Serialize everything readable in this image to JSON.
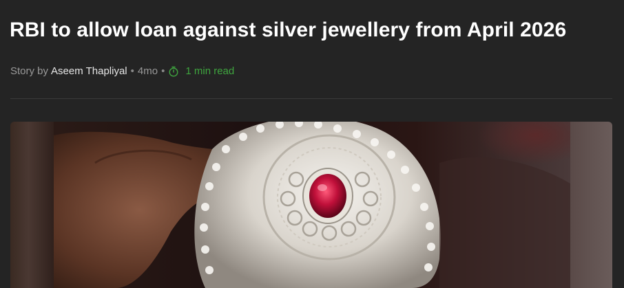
{
  "article": {
    "title": "RBI to allow loan against silver jewellery from April 2026",
    "byline": {
      "prefix": "Story by",
      "author": "Aseem Thapliyal",
      "age": "4mo",
      "read_time": "1 min read",
      "timer_icon": "timer-icon"
    },
    "hero_image": {
      "description_icon": "jewellery-photo"
    }
  },
  "colors": {
    "background": "#242424",
    "title": "#ffffff",
    "meta": "#9a9a9a",
    "author": "#e6e6e6",
    "read_time": "#3fa63f",
    "divider": "#3a3a3a"
  }
}
